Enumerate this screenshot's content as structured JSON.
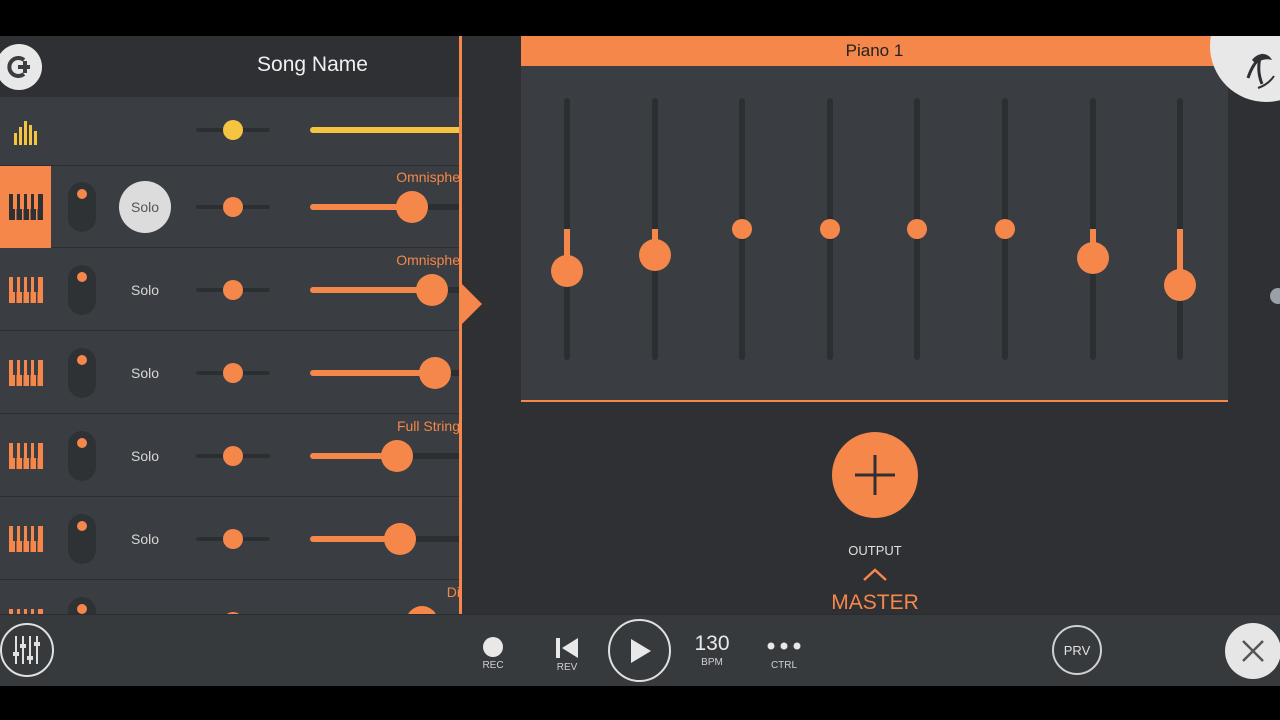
{
  "header": {
    "song_name": "Song Name"
  },
  "icons": {
    "logo": "fl-studio-logo-icon",
    "master_track": "bar-chart-icon",
    "instrument": "piano-keys-icon",
    "add": "plus-icon",
    "mixer": "mixer-sliders-icon",
    "close": "close-icon"
  },
  "channels": [
    {
      "type": "master",
      "pan": 0.5,
      "volume": 1.0,
      "plugin": ""
    },
    {
      "type": "instrument",
      "active": true,
      "solo_on": true,
      "solo_label": "Solo",
      "pan": 0.5,
      "volume": 0.67,
      "plugin": "Omnisphe"
    },
    {
      "type": "instrument",
      "active": false,
      "solo_on": false,
      "solo_label": "Solo",
      "pan": 0.5,
      "volume": 0.8,
      "plugin": "Omnisphe"
    },
    {
      "type": "instrument",
      "active": false,
      "solo_on": false,
      "solo_label": "Solo",
      "pan": 0.5,
      "volume": 0.82,
      "plugin": ""
    },
    {
      "type": "instrument",
      "active": false,
      "solo_on": false,
      "solo_label": "Solo",
      "pan": 0.5,
      "volume": 0.57,
      "plugin": "Full String"
    },
    {
      "type": "instrument",
      "active": false,
      "solo_on": false,
      "solo_label": "Solo",
      "pan": 0.5,
      "volume": 0.59,
      "plugin": ""
    },
    {
      "type": "instrument",
      "active": false,
      "solo_on": false,
      "solo_label": "",
      "pan": 0.5,
      "volume": 0.74,
      "plugin": "Di"
    }
  ],
  "mixer": {
    "title": "Piano 1",
    "faders": [
      -0.32,
      -0.2,
      0.0,
      0.0,
      0.0,
      0.0,
      -0.22,
      -0.43
    ]
  },
  "output": {
    "label": "OUTPUT",
    "target": "MASTER"
  },
  "transport": {
    "rec_label": "REC",
    "rev_label": "REV",
    "bpm_value": "130",
    "bpm_label": "BPM",
    "ctrl_label": "CTRL",
    "prv_label": "PRV"
  },
  "colors": {
    "accent": "#f5874a",
    "master_accent": "#f5c542",
    "panel": "#3a3d41",
    "background": "#2e3033"
  }
}
